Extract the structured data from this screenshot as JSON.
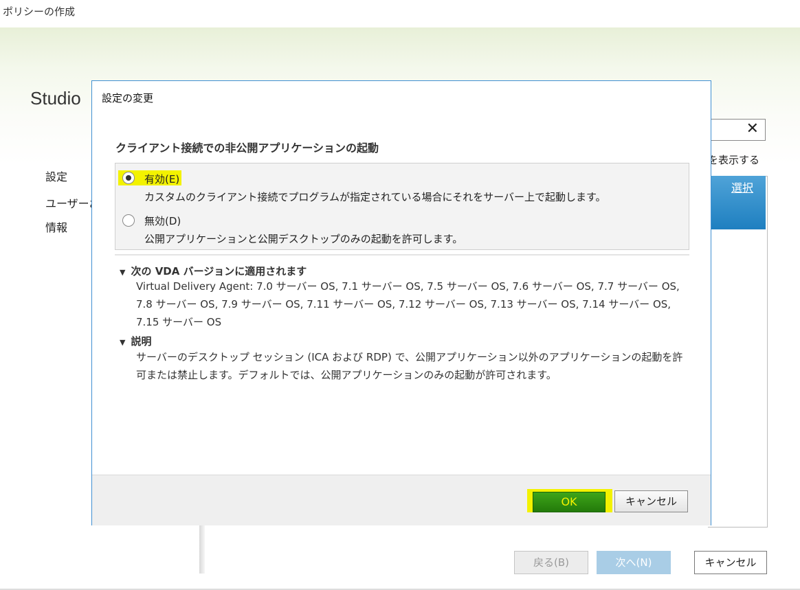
{
  "window": {
    "title": "ポリシーの作成"
  },
  "background": {
    "studio_label": "Studio",
    "nav": [
      "設定",
      "ユーザーお",
      "情報"
    ],
    "search_clear_symbol": "✕",
    "show_label": "を表示する",
    "select_link": "選択",
    "buttons": {
      "back": "戻る(B)",
      "next": "次へ(N)",
      "cancel": "キャンセル"
    }
  },
  "dialog": {
    "title": "設定の変更",
    "heading": "クライアント接続での非公開アプリケーションの起動",
    "options": [
      {
        "label": "有効(E)",
        "description": "カスタムのクライアント接続でプログラムが指定されている場合にそれをサーバー上で起動します。",
        "selected": true
      },
      {
        "label": "無効(D)",
        "description": "公開アプリケーションと公開デスクトップのみの起動を許可します。",
        "selected": false
      }
    ],
    "sections": [
      {
        "title": "次の VDA バージョンに適用されます",
        "body": "Virtual Delivery Agent: 7.0 サーバー OS, 7.1 サーバー OS, 7.5 サーバー OS, 7.6 サーバー OS, 7.7 サーバー OS, 7.8 サーバー OS, 7.9 サーバー OS, 7.11 サーバー OS, 7.12 サーバー OS, 7.13 サーバー OS, 7.14 サーバー OS, 7.15 サーバー OS"
      },
      {
        "title": "説明",
        "body": "サーバーのデスクトップ セッション (ICA および RDP) で、公開アプリケーション以外のアプリケーションの起動を許可または禁止します。デフォルトでは、公開アプリケーションのみの起動が許可されます。"
      }
    ],
    "buttons": {
      "ok": "OK",
      "cancel": "キャンセル"
    }
  },
  "colors": {
    "highlight": "#f3f200",
    "ok_green": "#2f8f12",
    "dialog_border": "#3f8fd2",
    "select_blue": "#1e7fc0"
  }
}
